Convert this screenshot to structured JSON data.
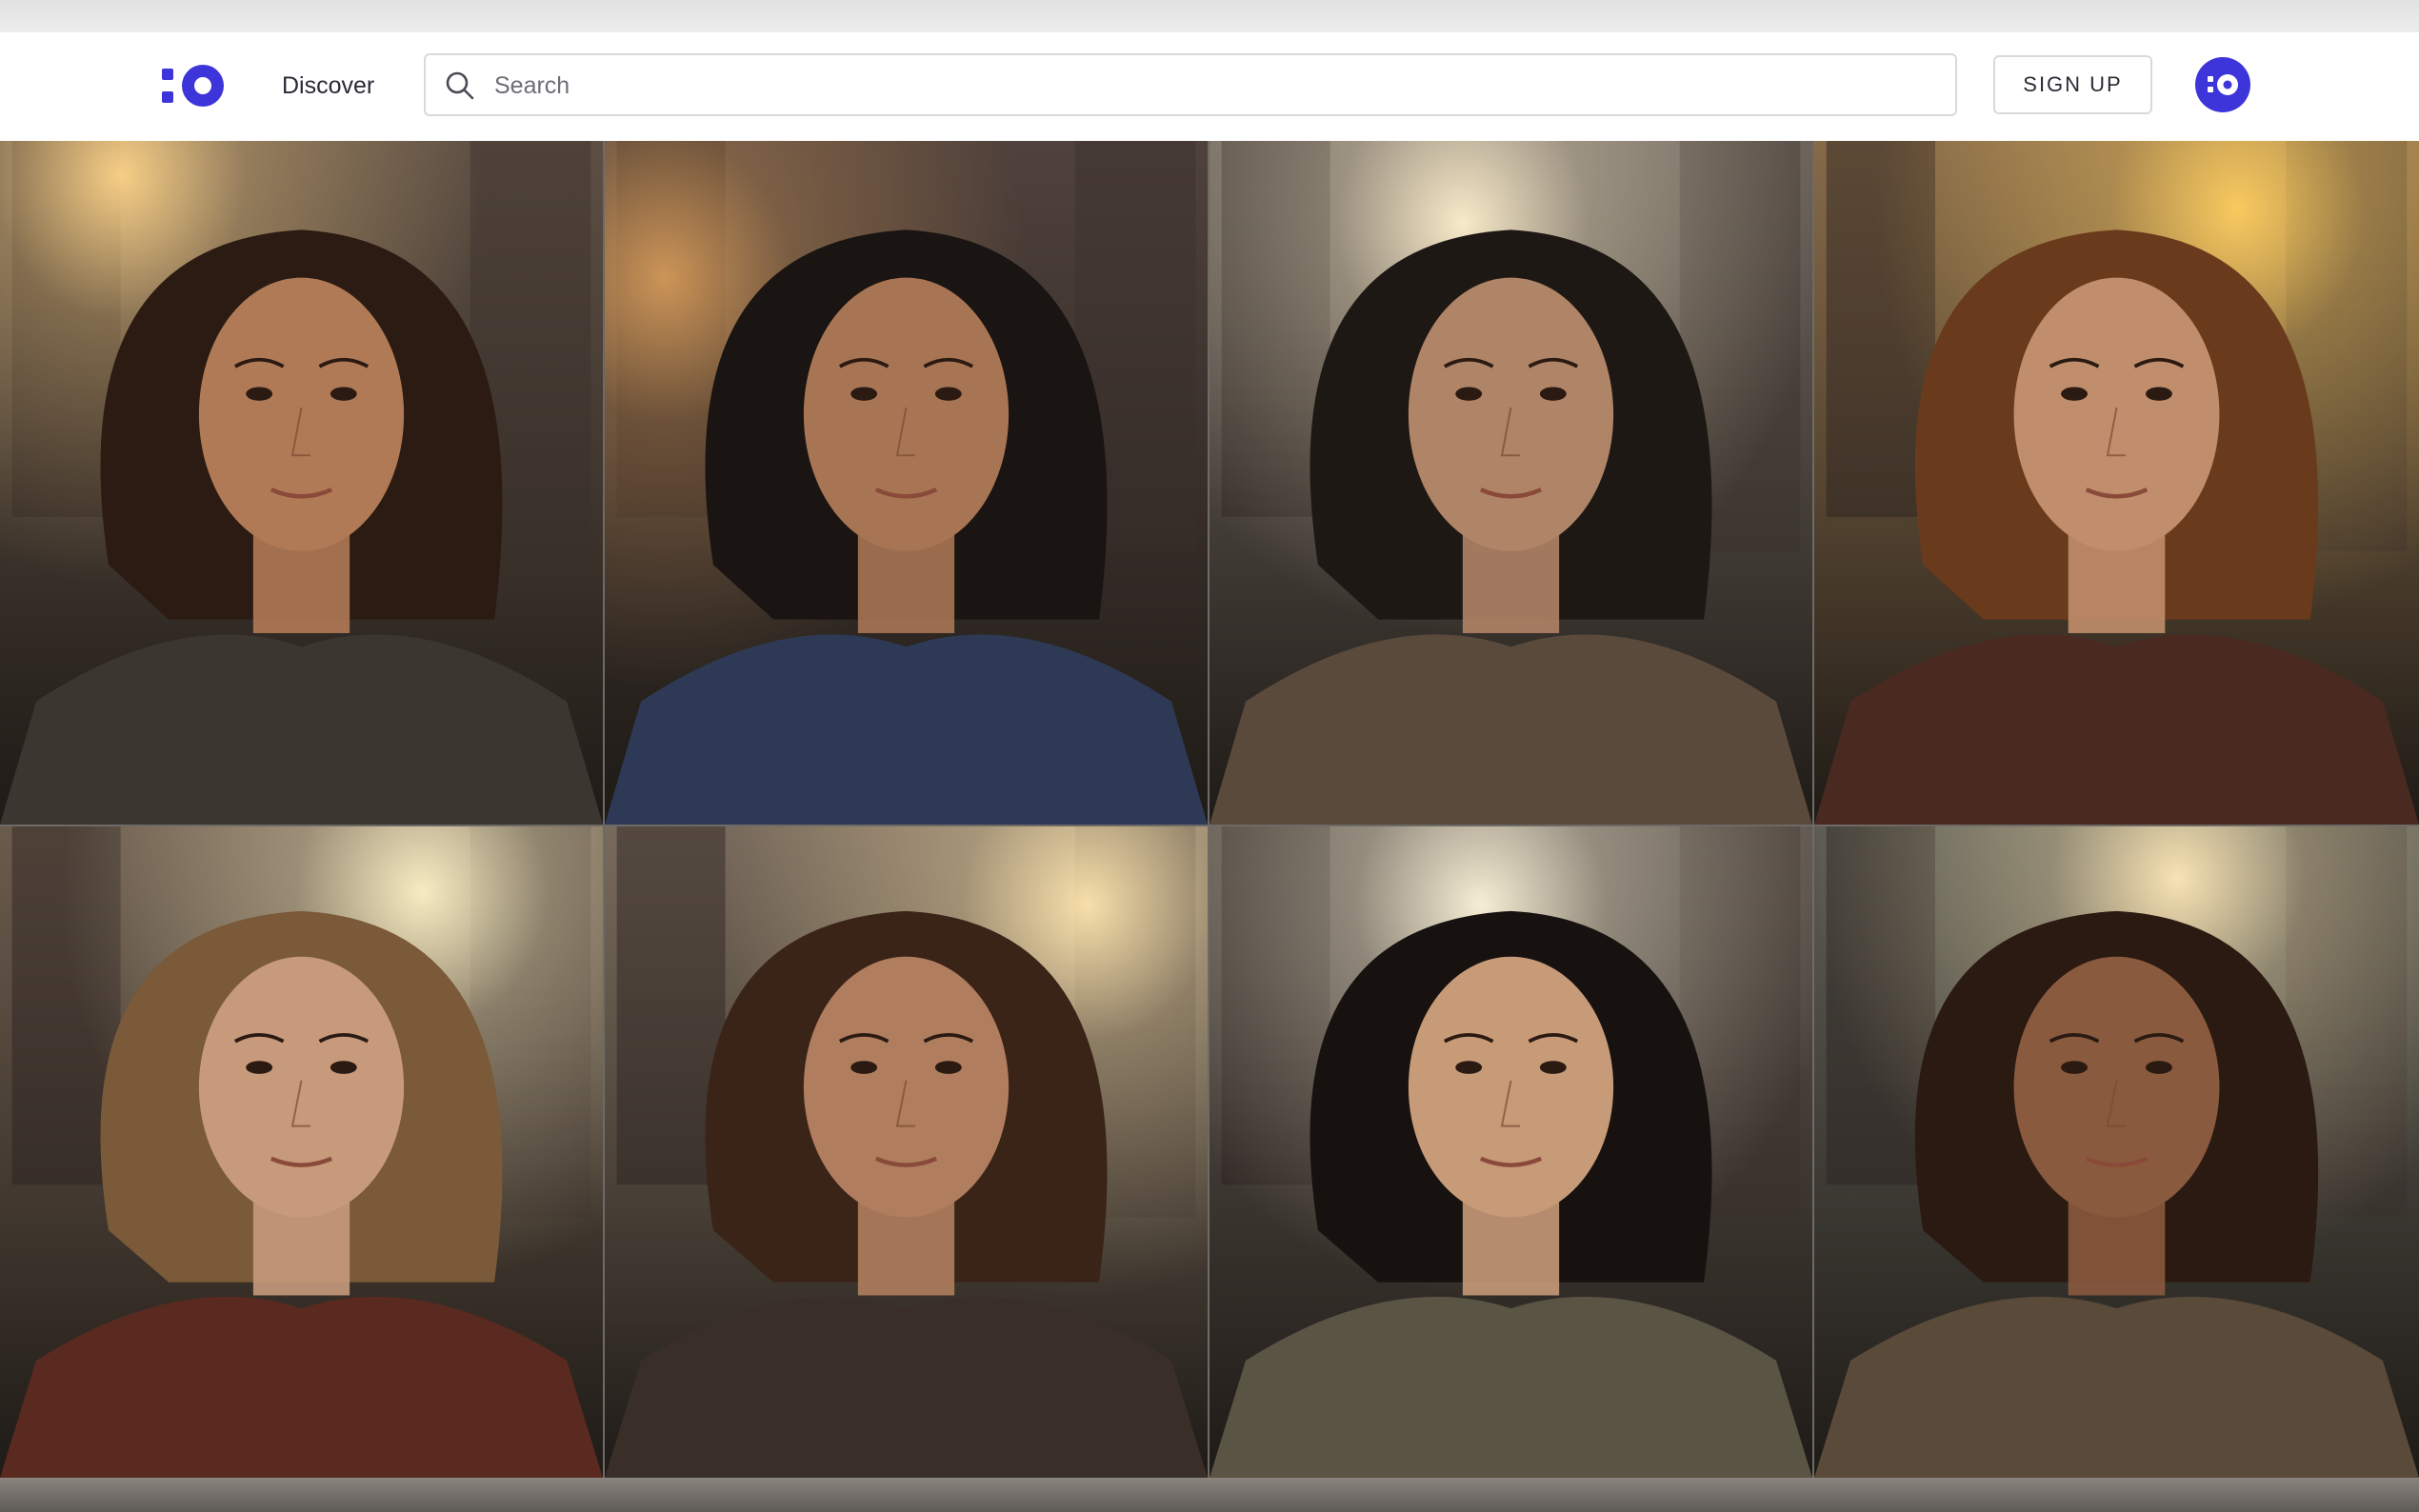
{
  "header": {
    "nav_discover": "Discover",
    "search_placeholder": "Search",
    "signup_label": "SIGN UP",
    "brand_color": "#3d35d9"
  },
  "gallery": {
    "items": [
      {
        "kind": "portrait",
        "skin": "#b07a56",
        "hair": "#2b1b12",
        "coat": "#3b3630",
        "bg": "#5a4a3e",
        "glow": "#ffd58a"
      },
      {
        "kind": "portrait",
        "skin": "#a87554",
        "hair": "#1a1412",
        "coat": "#2e3a55",
        "bg": "#4a3a34",
        "glow": "#d49a5a"
      },
      {
        "kind": "portrait",
        "skin": "#b08466",
        "hair": "#1e1814",
        "coat": "#5a4a3c",
        "bg": "#6a6058",
        "glow": "#fff1cf"
      },
      {
        "kind": "portrait",
        "skin": "#c08e6c",
        "hair": "#6a3a1c",
        "coat": "#4a2a20",
        "bg": "#8a6a44",
        "glow": "#ffcf60"
      },
      {
        "kind": "portrait",
        "skin": "#c79a7c",
        "hair": "#7a5a38",
        "coat": "#5a2a20",
        "bg": "#6a5848",
        "glow": "#fff3c8"
      },
      {
        "kind": "portrait",
        "skin": "#b07e5e",
        "hair": "#3a2418",
        "coat": "#3a2e28",
        "bg": "#7a6a5a",
        "glow": "#ffe7b0"
      },
      {
        "kind": "portrait",
        "skin": "#c79a78",
        "hair": "#171210",
        "coat": "#5a5444",
        "bg": "#5a5048",
        "glow": "#fff6dc"
      },
      {
        "kind": "portrait",
        "skin": "#8a5a3e",
        "hair": "#2a1a12",
        "coat": "#5a4a3a",
        "bg": "#5a5a50",
        "glow": "#ffe9b8"
      }
    ]
  }
}
